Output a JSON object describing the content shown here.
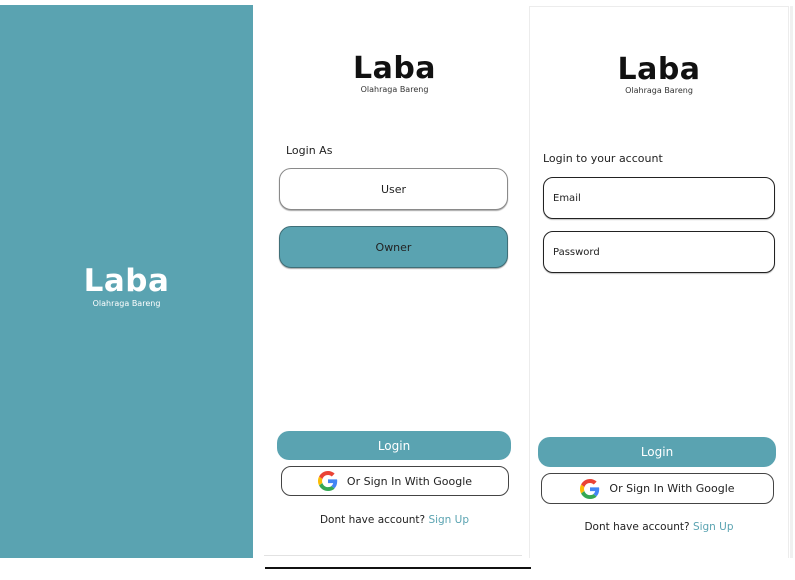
{
  "brand": {
    "name": "Laba",
    "tagline": "Olahraga Bareng"
  },
  "colors": {
    "primary": "#5aa3b1",
    "text": "#1a1a1a",
    "link": "#5aa3b1"
  },
  "role_screen": {
    "prompt": "Login As",
    "user_label": "User",
    "owner_label": "Owner",
    "login_label": "Login",
    "google_label": "Or Sign In With Google",
    "signup_prompt": "Dont have account?",
    "signup_link": "Sign Up"
  },
  "login_screen": {
    "prompt": "Login to your account",
    "email_placeholder": "Email",
    "password_placeholder": "Password",
    "login_label": "Login",
    "google_label": "Or Sign In With Google",
    "signup_prompt": "Dont have account?",
    "signup_link": "Sign Up"
  },
  "icons": {
    "google": "google-logo-icon"
  }
}
